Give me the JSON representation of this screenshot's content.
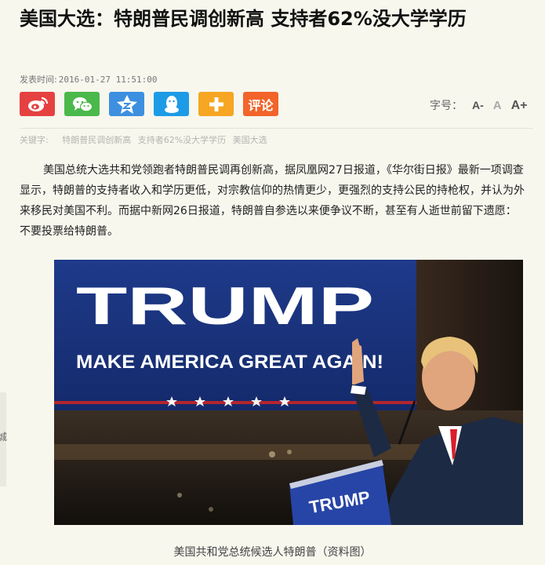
{
  "article": {
    "title": "美国大选：特朗普民调创新高 支持者62%没大学学历",
    "publish_label": "发表时间:",
    "publish_time": "2016-01-27 11:51:00",
    "body": "美国总统大选共和党领跑者特朗普民调再创新高，据凤凰网27日报道，《华尔街日报》最新一项调查显示，特朗普的支持者收入和学历更低，对宗教信仰的热情更少，更强烈的支持公民的持枪权，并认为外来移民对美国不利。而据中新网26日报道，特朗普自参选以来便争议不断，甚至有人逝世前留下遗愿：不要投票给特朗普。"
  },
  "share": {
    "comment_label": "评论",
    "icons": [
      "weibo-icon",
      "wechat-icon",
      "qzone-icon",
      "qq-icon",
      "plus-icon"
    ],
    "colors": {
      "weibo": "#e64141",
      "wechat": "#4bb84b",
      "qzone": "#3d8fe0",
      "qq": "#1d9be7",
      "plus": "#f6a623",
      "comment": "#f2642a"
    }
  },
  "font_size": {
    "label": "字号：",
    "small": "A-",
    "normal": "A",
    "large": "A+"
  },
  "keywords": {
    "label": "关键字:",
    "items": [
      "特朗普民调创新高",
      "支持者62%没大学学历",
      "美国大选"
    ]
  },
  "photo": {
    "banner_main": "TRUMP",
    "banner_slogan": "MAKE AMERICA GREAT AGAIN!",
    "podium_sign": "TRUMP",
    "caption": "美国共和党总统候选人特朗普（资料图）"
  },
  "edge_fragment": "城"
}
